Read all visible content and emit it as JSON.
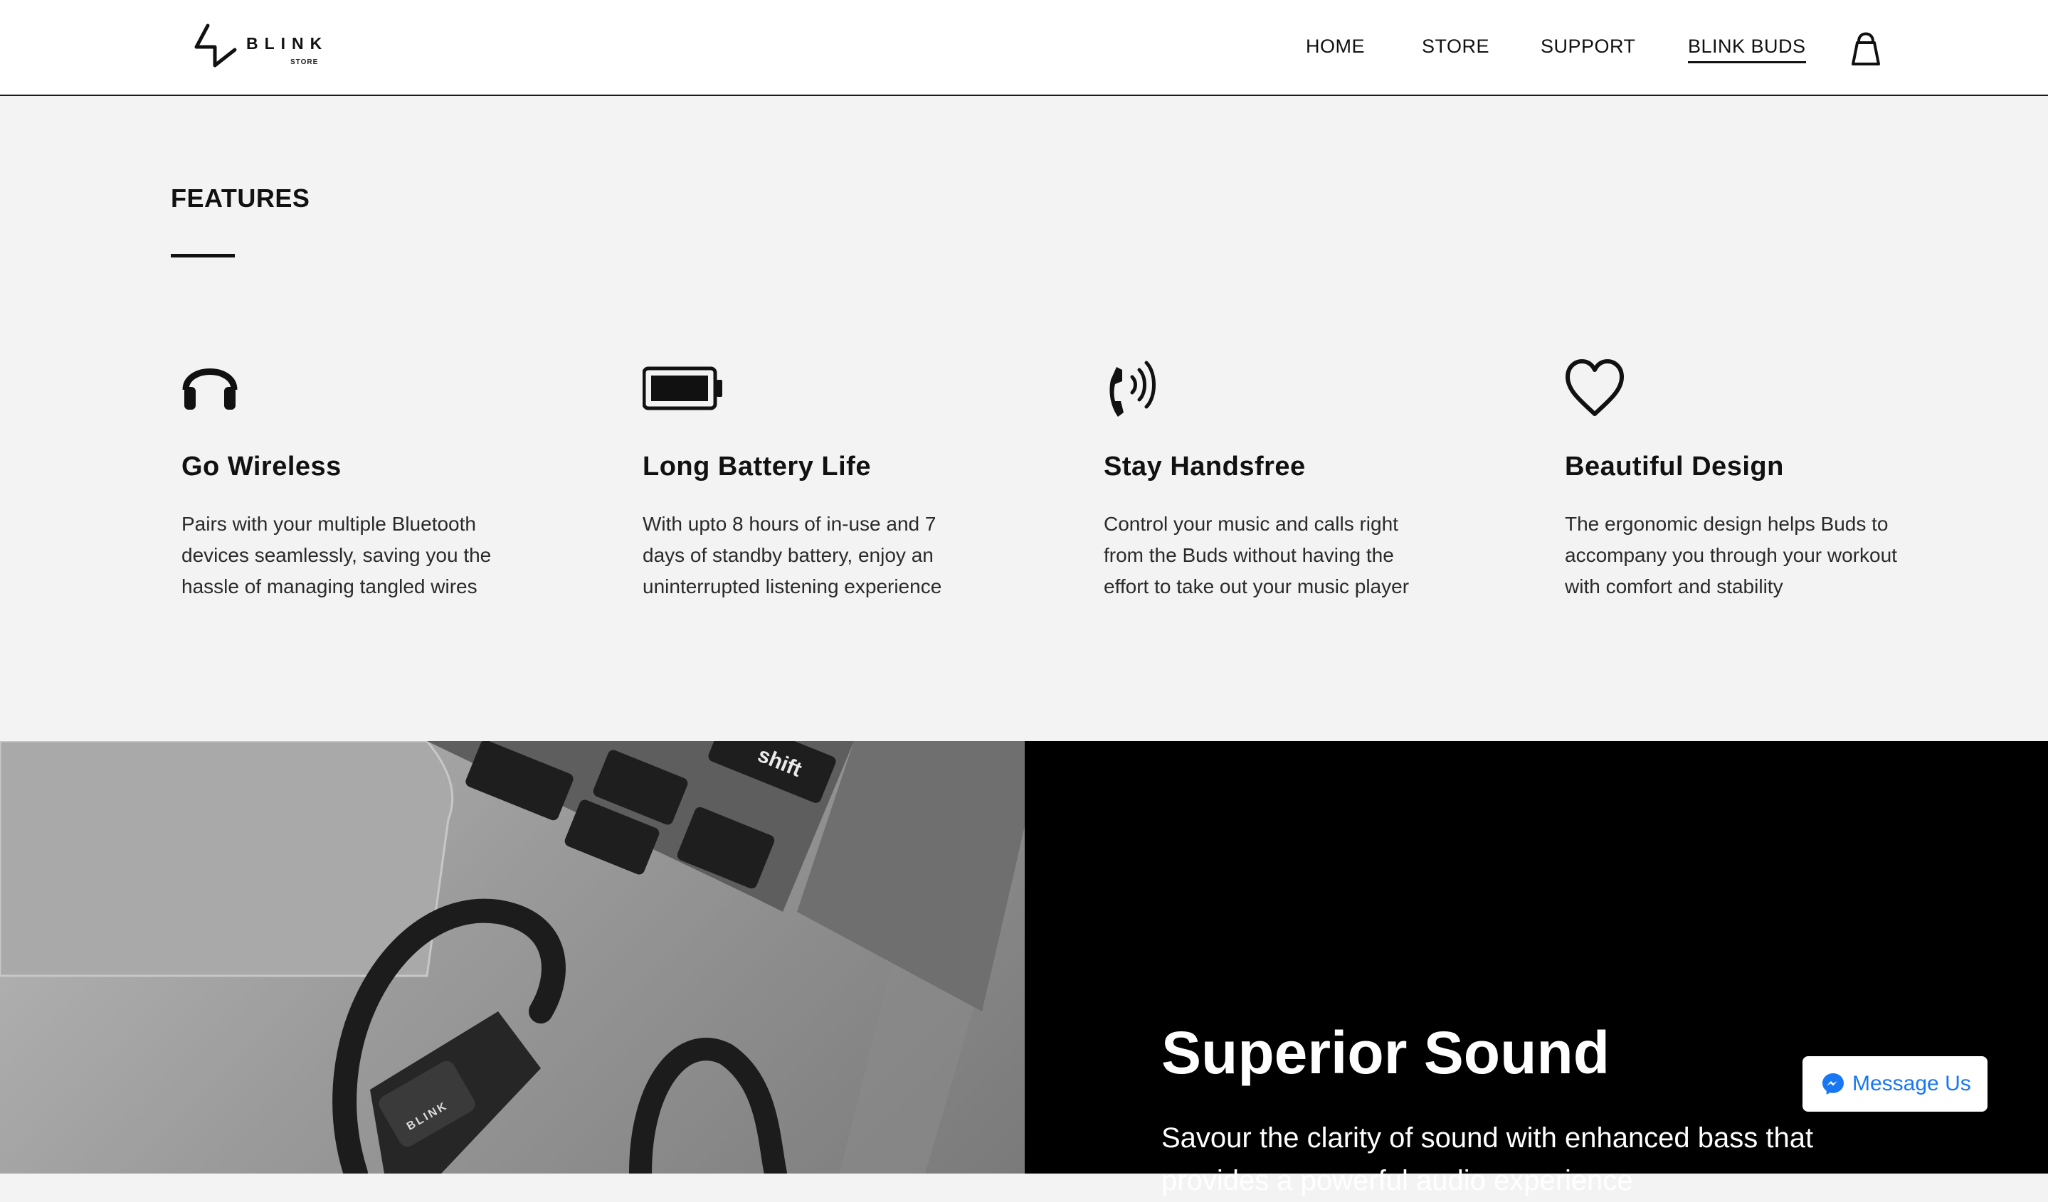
{
  "brand": {
    "logo_word": "BLINK",
    "logo_sub": "STORE"
  },
  "nav": {
    "items": [
      {
        "label": "HOME"
      },
      {
        "label": "STORE"
      },
      {
        "label": "SUPPORT"
      },
      {
        "label": "BLINK BUDS",
        "active": true
      }
    ]
  },
  "features": {
    "title": "FEATURES",
    "items": [
      {
        "icon": "headphones-icon",
        "title": "Go Wireless",
        "text": "Pairs with your multiple Bluetooth devices seamlessly, saving you the hassle of managing tangled wires"
      },
      {
        "icon": "battery-icon",
        "title": "Long Battery Life",
        "text": "With upto 8 hours of in-use and 7 days of standby battery, enjoy an uninterrupted listening experience"
      },
      {
        "icon": "phone-ringing-icon",
        "title": "Stay Handsfree",
        "text": "Control your music and calls right from the Buds without having the effort to take out your music player"
      },
      {
        "icon": "heart-icon",
        "title": "Beautiful Design",
        "text": "The ergonomic design helps Buds to accompany you through your workout with comfort and stability"
      }
    ]
  },
  "photo": {
    "keyboard_key": "shift",
    "product_logo": "BLINK"
  },
  "sound": {
    "title": "Superior Sound",
    "line1": "Savour the clarity of sound with enhanced bass that",
    "line2": "provides a powerful audio experience"
  },
  "messenger": {
    "label": "Message Us",
    "color": "#1877f2"
  },
  "colors": {
    "header_bg": "#ffffff",
    "page_bg": "#f3f3f3",
    "dark_panel": "#000000"
  }
}
